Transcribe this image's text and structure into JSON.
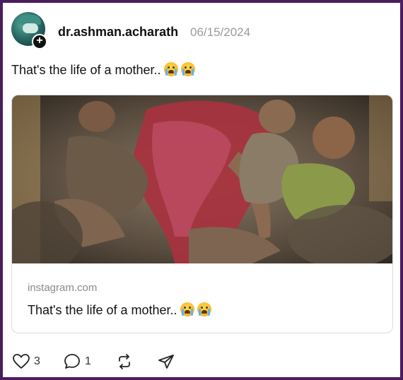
{
  "post": {
    "username": "dr.ashman.acharath",
    "date": "06/15/2024",
    "caption": "That's the life of a mother.."
  },
  "link_preview": {
    "domain": "instagram.com",
    "title": "That's the life of a mother.."
  },
  "actions": {
    "likes": "3",
    "replies": "1"
  },
  "icons": [
    "plus-icon",
    "heart-icon",
    "comment-icon",
    "repost-icon",
    "send-icon",
    "crying-emoji-icon"
  ],
  "colors": {
    "frame": "#4a1d5c",
    "muted": "#9a9a9a",
    "text": "#111111"
  }
}
